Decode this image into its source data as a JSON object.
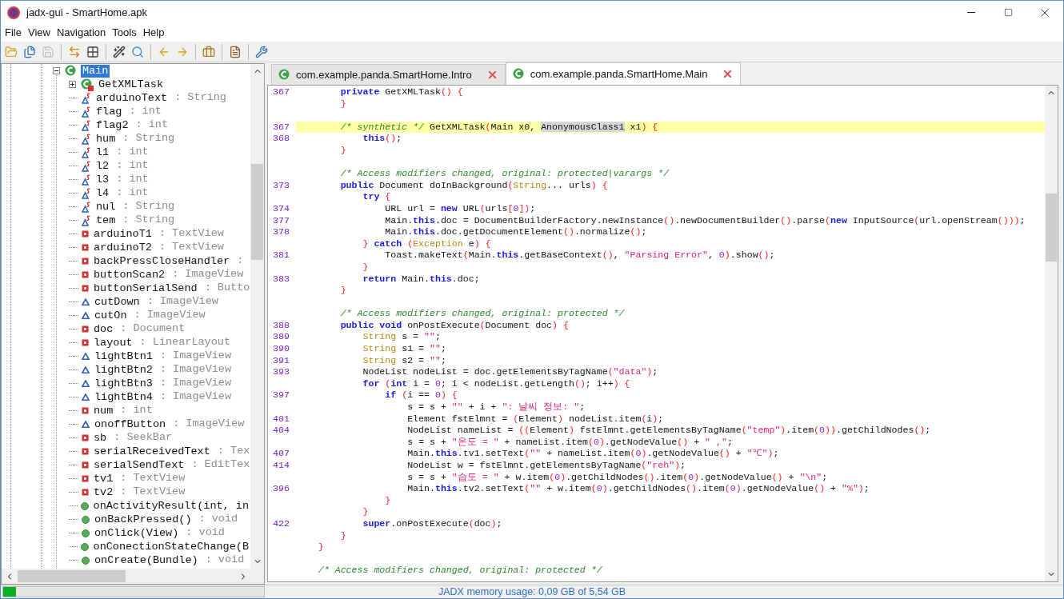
{
  "window": {
    "title": "jadx-gui - SmartHome.apk"
  },
  "menu": [
    "File",
    "View",
    "Navigation",
    "Tools",
    "Help"
  ],
  "toolbar": [
    {
      "kind": "open",
      "disabled": false
    },
    {
      "kind": "save_all",
      "disabled": false
    },
    {
      "kind": "save",
      "disabled": true
    },
    {
      "kind": "separator"
    },
    {
      "kind": "sync",
      "disabled": false
    },
    {
      "kind": "flatten",
      "disabled": false
    },
    {
      "kind": "separator"
    },
    {
      "kind": "wand",
      "disabled": false
    },
    {
      "kind": "search",
      "disabled": false
    },
    {
      "kind": "separator"
    },
    {
      "kind": "back",
      "disabled": false
    },
    {
      "kind": "forward",
      "disabled": false
    },
    {
      "kind": "separator"
    },
    {
      "kind": "deobf",
      "disabled": false
    },
    {
      "kind": "separator"
    },
    {
      "kind": "log",
      "disabled": false
    },
    {
      "kind": "separator"
    },
    {
      "kind": "prefs",
      "disabled": false
    }
  ],
  "tree": {
    "items": [
      {
        "label": "Main",
        "kind": "class",
        "selected": true,
        "expanded": true,
        "children": [
          {
            "label": "GetXMLTask",
            "kind": "inner_class",
            "selected": false,
            "expanded": false
          },
          {
            "label": "arduinoText",
            "detail": ": String",
            "kind": "static_field",
            "selected": false
          },
          {
            "label": "flag",
            "detail": ": int",
            "kind": "static_field",
            "selected": false
          },
          {
            "label": "flag2",
            "detail": ": int",
            "kind": "static_field",
            "selected": false
          },
          {
            "label": "hum",
            "detail": ": String",
            "kind": "static_field",
            "selected": false
          },
          {
            "label": "l1",
            "detail": ": int",
            "kind": "static_field",
            "selected": false
          },
          {
            "label": "l2",
            "detail": ": int",
            "kind": "static_field",
            "selected": false
          },
          {
            "label": "l3",
            "detail": ": int",
            "kind": "static_field",
            "selected": false
          },
          {
            "label": "l4",
            "detail": ": int",
            "kind": "static_field",
            "selected": false
          },
          {
            "label": "nul",
            "detail": ": String",
            "kind": "static_field",
            "selected": false
          },
          {
            "label": "tem",
            "detail": ": String",
            "kind": "static_field",
            "selected": false
          },
          {
            "label": "arduinoT1",
            "detail": ": TextView",
            "kind": "private_field",
            "selected": false
          },
          {
            "label": "arduinoT2",
            "detail": ": TextView",
            "kind": "private_field",
            "selected": false
          },
          {
            "label": "backPressCloseHandler",
            "detail": ":",
            "kind": "private_field",
            "selected": false
          },
          {
            "label": "buttonScan2",
            "detail": ": ImageView",
            "kind": "private_field",
            "selected": false
          },
          {
            "label": "buttonSerialSend",
            "detail": ": Butto",
            "kind": "private_field",
            "selected": false
          },
          {
            "label": "cutDown",
            "detail": ": ImageView",
            "kind": "protected_field",
            "selected": false
          },
          {
            "label": "cutOn",
            "detail": ": ImageView",
            "kind": "protected_field",
            "selected": false
          },
          {
            "label": "doc",
            "detail": ": Document",
            "kind": "private_field",
            "selected": false
          },
          {
            "label": "layout",
            "detail": ": LinearLayout",
            "kind": "private_field",
            "selected": false
          },
          {
            "label": "lightBtn1",
            "detail": ": ImageView",
            "kind": "protected_field",
            "selected": false
          },
          {
            "label": "lightBtn2",
            "detail": ": ImageView",
            "kind": "protected_field",
            "selected": false
          },
          {
            "label": "lightBtn3",
            "detail": ": ImageView",
            "kind": "protected_field",
            "selected": false
          },
          {
            "label": "lightBtn4",
            "detail": ": ImageView",
            "kind": "protected_field",
            "selected": false
          },
          {
            "label": "num",
            "detail": ": int",
            "kind": "private_field",
            "selected": false
          },
          {
            "label": "onoffButton",
            "detail": ": ImageView",
            "kind": "protected_field",
            "selected": false
          },
          {
            "label": "sb",
            "detail": ": SeekBar",
            "kind": "private_field",
            "selected": false
          },
          {
            "label": "serialReceivedText",
            "detail": ": Tex",
            "kind": "private_field",
            "selected": false
          },
          {
            "label": "serialSendText",
            "detail": ": EditTex",
            "kind": "private_field",
            "selected": false
          },
          {
            "label": "tv1",
            "detail": ": TextView",
            "kind": "private_field",
            "selected": false
          },
          {
            "label": "tv2",
            "detail": ": TextView",
            "kind": "private_field",
            "selected": false
          },
          {
            "label": "onActivityResult(int, in",
            "kind": "method",
            "selected": false
          },
          {
            "label": "onBackPressed()",
            "detail": ": void",
            "kind": "method",
            "selected": false
          },
          {
            "label": "onClick(View)",
            "detail": ": void",
            "kind": "method",
            "selected": false
          },
          {
            "label": "onConectionStateChange(B",
            "kind": "method",
            "selected": false
          },
          {
            "label": "onCreate(Bundle)",
            "detail": ": void",
            "kind": "method",
            "selected": false
          }
        ]
      }
    ]
  },
  "tabs": [
    {
      "label": "com.example.panda.SmartHome.Intro",
      "selected": false
    },
    {
      "label": "com.example.panda.SmartHome.Main",
      "selected": true
    }
  ],
  "code": [
    {
      "kind": "code",
      "current": false,
      "number": "367",
      "tokens": [
        {
          "kind": "keyword",
          "text": "        private"
        },
        {
          "kind": "plain",
          "text": " GetXMLTask"
        },
        {
          "kind": "brace",
          "text": "() {"
        }
      ]
    },
    {
      "kind": "code",
      "current": false,
      "tokens": [
        {
          "kind": "brace",
          "text": "        }"
        }
      ]
    },
    {
      "kind": "blank",
      "current": false
    },
    {
      "kind": "code",
      "current": true,
      "number": "367",
      "tokens": [
        {
          "kind": "comment",
          "text": "        /* synthetic */"
        },
        {
          "kind": "plain",
          "text": " GetXMLTask"
        },
        {
          "kind": "brace",
          "text": "("
        },
        {
          "kind": "plain",
          "text": "Main x0, "
        },
        {
          "kind": "highlight",
          "text": "AnonymousClass1"
        },
        {
          "kind": "plain",
          "text": " x1"
        },
        {
          "kind": "brace",
          "text": ") {"
        }
      ]
    },
    {
      "kind": "code",
      "current": false,
      "number": "368",
      "tokens": [
        {
          "kind": "keyword",
          "text": "            this"
        },
        {
          "kind": "brace",
          "text": "()"
        },
        {
          "kind": "plain",
          "text": ";"
        }
      ]
    },
    {
      "kind": "code",
      "current": false,
      "tokens": [
        {
          "kind": "brace",
          "text": "        }"
        }
      ]
    },
    {
      "kind": "blank",
      "current": false
    },
    {
      "kind": "code",
      "current": false,
      "tokens": [
        {
          "kind": "comment",
          "text": "        /* Access modifiers changed, original: protected|varargs */"
        }
      ]
    },
    {
      "kind": "code",
      "current": false,
      "number": "373",
      "tokens": [
        {
          "kind": "keyword",
          "text": "        public"
        },
        {
          "kind": "plain",
          "text": " Document doInBackground"
        },
        {
          "kind": "brace",
          "text": "("
        },
        {
          "kind": "type",
          "text": "String"
        },
        {
          "kind": "plain",
          "text": "... urls"
        },
        {
          "kind": "brace",
          "text": ") {"
        }
      ]
    },
    {
      "kind": "code",
      "current": false,
      "tokens": [
        {
          "kind": "keyword",
          "text": "            try"
        },
        {
          "kind": "brace",
          "text": " {"
        }
      ]
    },
    {
      "kind": "code",
      "current": false,
      "number": "374",
      "tokens": [
        {
          "kind": "plain",
          "text": "                URL url = "
        },
        {
          "kind": "keyword",
          "text": "new"
        },
        {
          "kind": "plain",
          "text": " URL"
        },
        {
          "kind": "brace",
          "text": "("
        },
        {
          "kind": "plain",
          "text": "urls"
        },
        {
          "kind": "brace",
          "text": "["
        },
        {
          "kind": "number",
          "text": "0"
        },
        {
          "kind": "brace",
          "text": "])"
        },
        {
          "kind": "plain",
          "text": ";"
        }
      ]
    },
    {
      "kind": "code",
      "current": false,
      "number": "377",
      "tokens": [
        {
          "kind": "plain",
          "text": "                Main."
        },
        {
          "kind": "keyword",
          "text": "this"
        },
        {
          "kind": "plain",
          "text": ".doc = DocumentBuilderFactory.newInstance"
        },
        {
          "kind": "brace",
          "text": "()"
        },
        {
          "kind": "plain",
          "text": ".newDocumentBuilder"
        },
        {
          "kind": "brace",
          "text": "()"
        },
        {
          "kind": "plain",
          "text": ".parse"
        },
        {
          "kind": "brace",
          "text": "("
        },
        {
          "kind": "keyword",
          "text": "new"
        },
        {
          "kind": "plain",
          "text": " InputSource"
        },
        {
          "kind": "brace",
          "text": "("
        },
        {
          "kind": "plain",
          "text": "url.openStream"
        },
        {
          "kind": "brace",
          "text": "()))"
        },
        {
          "kind": "plain",
          "text": ";"
        }
      ]
    },
    {
      "kind": "code",
      "current": false,
      "number": "378",
      "tokens": [
        {
          "kind": "plain",
          "text": "                Main."
        },
        {
          "kind": "keyword",
          "text": "this"
        },
        {
          "kind": "plain",
          "text": ".doc.getDocumentElement"
        },
        {
          "kind": "brace",
          "text": "()"
        },
        {
          "kind": "plain",
          "text": ".normalize"
        },
        {
          "kind": "brace",
          "text": "()"
        },
        {
          "kind": "plain",
          "text": ";"
        }
      ]
    },
    {
      "kind": "code",
      "current": false,
      "tokens": [
        {
          "kind": "brace",
          "text": "            }"
        },
        {
          "kind": "keyword",
          "text": " catch"
        },
        {
          "kind": "brace",
          "text": " ("
        },
        {
          "kind": "type",
          "text": "Exception"
        },
        {
          "kind": "plain",
          "text": " e"
        },
        {
          "kind": "brace",
          "text": ") {"
        }
      ]
    },
    {
      "kind": "code",
      "current": false,
      "number": "381",
      "tokens": [
        {
          "kind": "plain",
          "text": "                Toast.makeText"
        },
        {
          "kind": "brace",
          "text": "("
        },
        {
          "kind": "plain",
          "text": "Main."
        },
        {
          "kind": "keyword",
          "text": "this"
        },
        {
          "kind": "plain",
          "text": ".getBaseContext"
        },
        {
          "kind": "brace",
          "text": "()"
        },
        {
          "kind": "plain",
          "text": ", "
        },
        {
          "kind": "string",
          "text": "\"Parsing Error\""
        },
        {
          "kind": "plain",
          "text": ", "
        },
        {
          "kind": "number",
          "text": "0"
        },
        {
          "kind": "brace",
          "text": ")"
        },
        {
          "kind": "plain",
          "text": ".show"
        },
        {
          "kind": "brace",
          "text": "()"
        },
        {
          "kind": "plain",
          "text": ";"
        }
      ]
    },
    {
      "kind": "code",
      "current": false,
      "tokens": [
        {
          "kind": "brace",
          "text": "            }"
        }
      ]
    },
    {
      "kind": "code",
      "current": false,
      "number": "383",
      "tokens": [
        {
          "kind": "keyword",
          "text": "            return"
        },
        {
          "kind": "plain",
          "text": " Main."
        },
        {
          "kind": "keyword",
          "text": "this"
        },
        {
          "kind": "plain",
          "text": ".doc;"
        }
      ]
    },
    {
      "kind": "code",
      "current": false,
      "tokens": [
        {
          "kind": "brace",
          "text": "        }"
        }
      ]
    },
    {
      "kind": "blank",
      "current": false
    },
    {
      "kind": "code",
      "current": false,
      "tokens": [
        {
          "kind": "comment",
          "text": "        /* Access modifiers changed, original: protected */"
        }
      ]
    },
    {
      "kind": "code",
      "current": false,
      "number": "388",
      "tokens": [
        {
          "kind": "keyword",
          "text": "        public"
        },
        {
          "kind": "keyword",
          "text": " void"
        },
        {
          "kind": "plain",
          "text": " onPostExecute"
        },
        {
          "kind": "brace",
          "text": "("
        },
        {
          "kind": "plain",
          "text": "Document doc"
        },
        {
          "kind": "brace",
          "text": ") {"
        }
      ]
    },
    {
      "kind": "code",
      "current": false,
      "number": "389",
      "tokens": [
        {
          "kind": "type",
          "text": "            String"
        },
        {
          "kind": "plain",
          "text": " s = "
        },
        {
          "kind": "string",
          "text": "\"\""
        },
        {
          "kind": "plain",
          "text": ";"
        }
      ]
    },
    {
      "kind": "code",
      "current": false,
      "number": "390",
      "tokens": [
        {
          "kind": "type",
          "text": "            String"
        },
        {
          "kind": "plain",
          "text": " s1 = "
        },
        {
          "kind": "string",
          "text": "\"\""
        },
        {
          "kind": "plain",
          "text": ";"
        }
      ]
    },
    {
      "kind": "code",
      "current": false,
      "number": "391",
      "tokens": [
        {
          "kind": "type",
          "text": "            String"
        },
        {
          "kind": "plain",
          "text": " s2 = "
        },
        {
          "kind": "string",
          "text": "\"\""
        },
        {
          "kind": "plain",
          "text": ";"
        }
      ]
    },
    {
      "kind": "code",
      "current": false,
      "number": "393",
      "tokens": [
        {
          "kind": "plain",
          "text": "            NodeList nodeList = doc.getElementsByTagName"
        },
        {
          "kind": "brace",
          "text": "("
        },
        {
          "kind": "string",
          "text": "\"data\""
        },
        {
          "kind": "brace",
          "text": ")"
        },
        {
          "kind": "plain",
          "text": ";"
        }
      ]
    },
    {
      "kind": "code",
      "current": false,
      "tokens": [
        {
          "kind": "keyword",
          "text": "            for"
        },
        {
          "kind": "brace",
          "text": " ("
        },
        {
          "kind": "keyword",
          "text": "int"
        },
        {
          "kind": "plain",
          "text": " i = "
        },
        {
          "kind": "number",
          "text": "0"
        },
        {
          "kind": "plain",
          "text": "; i < nodeList.getLength"
        },
        {
          "kind": "brace",
          "text": "()"
        },
        {
          "kind": "plain",
          "text": "; i++"
        },
        {
          "kind": "brace",
          "text": ") {"
        }
      ]
    },
    {
      "kind": "code",
      "current": false,
      "number": "397",
      "tokens": [
        {
          "kind": "keyword",
          "text": "                if"
        },
        {
          "kind": "brace",
          "text": " ("
        },
        {
          "kind": "plain",
          "text": "i == "
        },
        {
          "kind": "number",
          "text": "0"
        },
        {
          "kind": "brace",
          "text": ") {"
        }
      ]
    },
    {
      "kind": "code",
      "current": false,
      "tokens": [
        {
          "kind": "plain",
          "text": "                    s = s + "
        },
        {
          "kind": "string",
          "text": "\"\""
        },
        {
          "kind": "plain",
          "text": " + i + "
        },
        {
          "kind": "string",
          "text": "\": 날씨 정보: \""
        },
        {
          "kind": "plain",
          "text": ";"
        }
      ]
    },
    {
      "kind": "code",
      "current": false,
      "number": "401",
      "tokens": [
        {
          "kind": "plain",
          "text": "                    Element fstElmnt = "
        },
        {
          "kind": "brace",
          "text": "("
        },
        {
          "kind": "plain",
          "text": "Element"
        },
        {
          "kind": "brace",
          "text": ")"
        },
        {
          "kind": "plain",
          "text": " nodeList.item"
        },
        {
          "kind": "brace",
          "text": "("
        },
        {
          "kind": "plain",
          "text": "i"
        },
        {
          "kind": "brace",
          "text": ")"
        },
        {
          "kind": "plain",
          "text": ";"
        }
      ]
    },
    {
      "kind": "code",
      "current": false,
      "number": "404",
      "tokens": [
        {
          "kind": "plain",
          "text": "                    NodeList nameList = "
        },
        {
          "kind": "brace",
          "text": "(("
        },
        {
          "kind": "plain",
          "text": "Element"
        },
        {
          "kind": "brace",
          "text": ")"
        },
        {
          "kind": "plain",
          "text": " fstElmnt.getElementsByTagName"
        },
        {
          "kind": "brace",
          "text": "("
        },
        {
          "kind": "string",
          "text": "\"temp\""
        },
        {
          "kind": "brace",
          "text": ")"
        },
        {
          "kind": "plain",
          "text": ".item"
        },
        {
          "kind": "brace",
          "text": "("
        },
        {
          "kind": "number",
          "text": "0"
        },
        {
          "kind": "brace",
          "text": "))"
        },
        {
          "kind": "plain",
          "text": ".getChildNodes"
        },
        {
          "kind": "brace",
          "text": "()"
        },
        {
          "kind": "plain",
          "text": ";"
        }
      ]
    },
    {
      "kind": "code",
      "current": false,
      "tokens": [
        {
          "kind": "plain",
          "text": "                    s = s + "
        },
        {
          "kind": "string",
          "text": "\"온도 = \""
        },
        {
          "kind": "plain",
          "text": " + nameList.item"
        },
        {
          "kind": "brace",
          "text": "("
        },
        {
          "kind": "number",
          "text": "0"
        },
        {
          "kind": "brace",
          "text": ")"
        },
        {
          "kind": "plain",
          "text": ".getNodeValue"
        },
        {
          "kind": "brace",
          "text": "()"
        },
        {
          "kind": "plain",
          "text": " + "
        },
        {
          "kind": "string",
          "text": "\" ,\""
        },
        {
          "kind": "plain",
          "text": ";"
        }
      ]
    },
    {
      "kind": "code",
      "current": false,
      "number": "407",
      "tokens": [
        {
          "kind": "plain",
          "text": "                    Main."
        },
        {
          "kind": "keyword",
          "text": "this"
        },
        {
          "kind": "plain",
          "text": ".tv1.setText"
        },
        {
          "kind": "brace",
          "text": "("
        },
        {
          "kind": "string",
          "text": "\"\""
        },
        {
          "kind": "plain",
          "text": " + nameList.item"
        },
        {
          "kind": "brace",
          "text": "("
        },
        {
          "kind": "number",
          "text": "0"
        },
        {
          "kind": "brace",
          "text": ")"
        },
        {
          "kind": "plain",
          "text": ".getNodeValue"
        },
        {
          "kind": "brace",
          "text": "()"
        },
        {
          "kind": "plain",
          "text": " + "
        },
        {
          "kind": "string",
          "text": "\"℃\""
        },
        {
          "kind": "brace",
          "text": ")"
        },
        {
          "kind": "plain",
          "text": ";"
        }
      ]
    },
    {
      "kind": "code",
      "current": false,
      "number": "414",
      "tokens": [
        {
          "kind": "plain",
          "text": "                    NodeList w = fstElmnt.getElementsByTagName"
        },
        {
          "kind": "brace",
          "text": "("
        },
        {
          "kind": "string",
          "text": "\"reh\""
        },
        {
          "kind": "brace",
          "text": ")"
        },
        {
          "kind": "plain",
          "text": ";"
        }
      ]
    },
    {
      "kind": "code",
      "current": false,
      "tokens": [
        {
          "kind": "plain",
          "text": "                    s = s + "
        },
        {
          "kind": "string",
          "text": "\"습도 = \""
        },
        {
          "kind": "plain",
          "text": " + w.item"
        },
        {
          "kind": "brace",
          "text": "("
        },
        {
          "kind": "number",
          "text": "0"
        },
        {
          "kind": "brace",
          "text": ")"
        },
        {
          "kind": "plain",
          "text": ".getChildNodes"
        },
        {
          "kind": "brace",
          "text": "()"
        },
        {
          "kind": "plain",
          "text": ".item"
        },
        {
          "kind": "brace",
          "text": "("
        },
        {
          "kind": "number",
          "text": "0"
        },
        {
          "kind": "brace",
          "text": ")"
        },
        {
          "kind": "plain",
          "text": ".getNodeValue"
        },
        {
          "kind": "brace",
          "text": "()"
        },
        {
          "kind": "plain",
          "text": " + "
        },
        {
          "kind": "string",
          "text": "\"\\n\""
        },
        {
          "kind": "plain",
          "text": ";"
        }
      ]
    },
    {
      "kind": "code",
      "current": false,
      "number": "396",
      "tokens": [
        {
          "kind": "plain",
          "text": "                    Main."
        },
        {
          "kind": "keyword",
          "text": "this"
        },
        {
          "kind": "plain",
          "text": ".tv2.setText"
        },
        {
          "kind": "brace",
          "text": "("
        },
        {
          "kind": "string",
          "text": "\"\""
        },
        {
          "kind": "plain",
          "text": " + w.item"
        },
        {
          "kind": "brace",
          "text": "("
        },
        {
          "kind": "number",
          "text": "0"
        },
        {
          "kind": "brace",
          "text": ")"
        },
        {
          "kind": "plain",
          "text": ".getChildNodes"
        },
        {
          "kind": "brace",
          "text": "()"
        },
        {
          "kind": "plain",
          "text": ".item"
        },
        {
          "kind": "brace",
          "text": "("
        },
        {
          "kind": "number",
          "text": "0"
        },
        {
          "kind": "brace",
          "text": ")"
        },
        {
          "kind": "plain",
          "text": ".getNodeValue"
        },
        {
          "kind": "brace",
          "text": "()"
        },
        {
          "kind": "plain",
          "text": " + "
        },
        {
          "kind": "string",
          "text": "\"%\""
        },
        {
          "kind": "brace",
          "text": ")"
        },
        {
          "kind": "plain",
          "text": ";"
        }
      ]
    },
    {
      "kind": "code",
      "current": false,
      "tokens": [
        {
          "kind": "brace",
          "text": "                }"
        }
      ]
    },
    {
      "kind": "code",
      "current": false,
      "tokens": [
        {
          "kind": "brace",
          "text": "            }"
        }
      ]
    },
    {
      "kind": "code",
      "current": false,
      "number": "422",
      "tokens": [
        {
          "kind": "keyword",
          "text": "            super"
        },
        {
          "kind": "plain",
          "text": ".onPostExecute"
        },
        {
          "kind": "brace",
          "text": "("
        },
        {
          "kind": "plain",
          "text": "doc"
        },
        {
          "kind": "brace",
          "text": ")"
        },
        {
          "kind": "plain",
          "text": ";"
        }
      ]
    },
    {
      "kind": "code",
      "current": false,
      "tokens": [
        {
          "kind": "brace",
          "text": "        }"
        }
      ]
    },
    {
      "kind": "code",
      "current": false,
      "tokens": [
        {
          "kind": "brace",
          "text": "    }"
        }
      ]
    },
    {
      "kind": "blank",
      "current": false
    },
    {
      "kind": "code",
      "current": false,
      "tokens": [
        {
          "kind": "comment",
          "text": "    /* Access modifiers changed, original: protected */"
        }
      ]
    }
  ],
  "status_bar": {
    "memory_bar": {
      "level": 0.05
    },
    "text": "JADX memory usage: 0,09 GB of 5,54 GB"
  }
}
